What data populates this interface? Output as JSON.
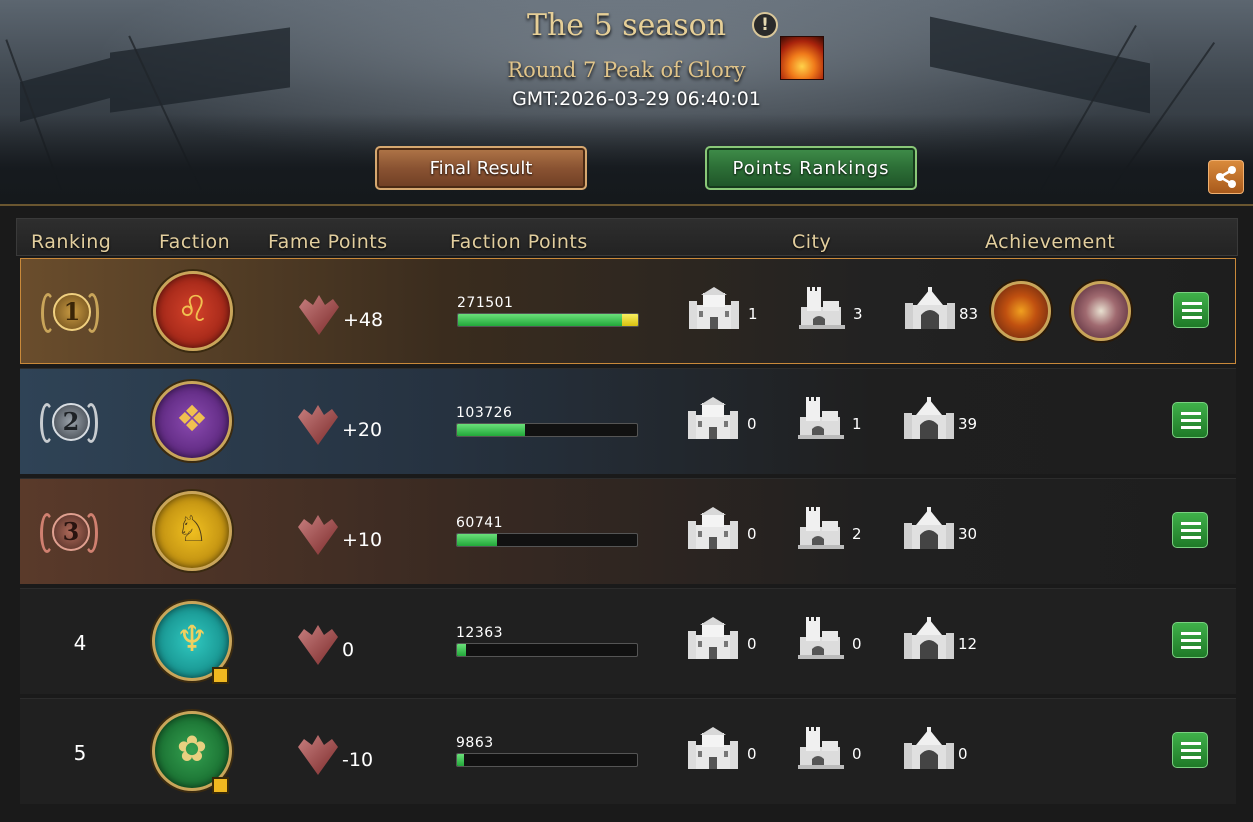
{
  "header": {
    "title": "The 5 season",
    "round": "Round 7 Peak of Glory",
    "gmt": "GMT:2026-03-29 06:40:01",
    "final_result_label": "Final Result",
    "points_rankings_label": "Points Rankings"
  },
  "columns": {
    "ranking": "Ranking",
    "faction": "Faction",
    "fame_points": "Fame Points",
    "faction_points": "Faction Points",
    "city": "City",
    "achievement": "Achievement"
  },
  "rows": [
    {
      "rank": "1",
      "medal": "gold",
      "faction_color": "#c8321e",
      "fame": "+48",
      "faction_points": "271501",
      "points_fraction": 1.0,
      "city_a": "1",
      "city_b": "3",
      "city_c": "83",
      "achievements": [
        "flame-shield-badge",
        "sword-badge"
      ]
    },
    {
      "rank": "2",
      "medal": "silver",
      "faction_color": "#7a3aa0",
      "fame": "+20",
      "faction_points": "103726",
      "points_fraction": 0.38,
      "city_a": "0",
      "city_b": "1",
      "city_c": "39",
      "achievements": []
    },
    {
      "rank": "3",
      "medal": "bronze",
      "faction_color": "#e0b010",
      "fame": "+10",
      "faction_points": "60741",
      "points_fraction": 0.22,
      "city_a": "0",
      "city_b": "2",
      "city_c": "30",
      "achievements": []
    },
    {
      "rank": "4",
      "medal": "none",
      "faction_color": "#1ab0a8",
      "fame": "0",
      "faction_points": "12363",
      "points_fraction": 0.05,
      "city_a": "0",
      "city_b": "0",
      "city_c": "12",
      "achievements": []
    },
    {
      "rank": "5",
      "medal": "none",
      "faction_color": "#1e8a3a",
      "fame": "-10",
      "faction_points": "9863",
      "points_fraction": 0.04,
      "city_a": "0",
      "city_b": "0",
      "city_c": "0",
      "achievements": []
    }
  ],
  "icons": {
    "info": "info-icon",
    "season_flame": "fire-icon",
    "share": "share-icon",
    "fame": "dragon-wing-icon",
    "city_a": "castle-icon",
    "city_b": "fortress-icon",
    "city_c": "gate-icon",
    "details": "list-icon"
  },
  "colors": {
    "gold_text": "#e6cf97",
    "green_button": "#2c6e36",
    "brown_button": "#8a5332",
    "progress_green": "#22a83a",
    "progress_gold": "#d8c010"
  }
}
